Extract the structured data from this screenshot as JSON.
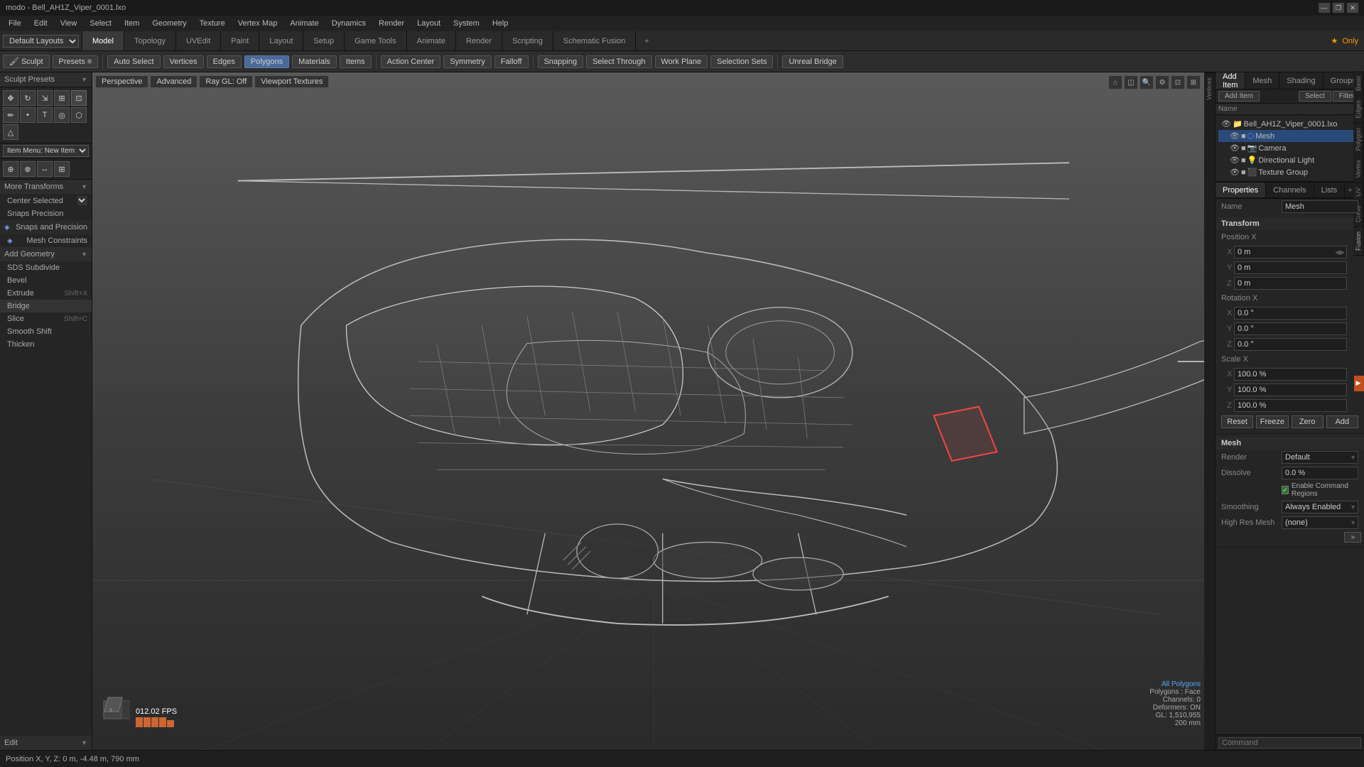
{
  "app": {
    "title": "modo - Bell_AH1Z_Viper_0001.lxo",
    "version": "modo"
  },
  "titlebar": {
    "title": "modo",
    "controls": [
      "—",
      "❐",
      "✕"
    ]
  },
  "menubar": {
    "items": [
      "File",
      "Edit",
      "View",
      "Select",
      "Item",
      "Geometry",
      "Texture",
      "Vertex Map",
      "Animate",
      "Dynamics",
      "Render",
      "Layout",
      "System",
      "Help"
    ]
  },
  "layout_dropdown": "Default Layouts",
  "modetabs": {
    "tabs": [
      "Model",
      "Topology",
      "UVEdit",
      "Paint",
      "Layout",
      "Setup",
      "Game Tools",
      "Animate",
      "Render",
      "Scripting",
      "Schematic Fusion"
    ],
    "active": "Model",
    "add": "+",
    "right": {
      "label": "Only",
      "star": "★"
    }
  },
  "toolbar": {
    "sculpt_label": "Sculpt",
    "presets_label": "Presets",
    "presets_icon": "≡",
    "auto_select": "Auto Select",
    "vertices": "Vertices",
    "edges": "Edges",
    "polygons": "Polygons",
    "materials": "Materials",
    "items": "Items",
    "action_center": "Action Center",
    "symmetry": "Symmetry",
    "falloff": "Falloff",
    "snapping": "Snapping",
    "select_through": "Select Through",
    "work_plane": "Work Plane",
    "selection_sets": "Selection Sets",
    "unreal_bridge": "Unreal Bridge"
  },
  "viewport": {
    "mode": "Perspective",
    "display": "Advanced",
    "render": "Ray GL: Off",
    "textures": "Viewport Textures"
  },
  "left_sidebar": {
    "sculpt_presets_label": "Sculpt Presets",
    "transforms_label": "More Transforms",
    "center_selected": "Center Selected",
    "snaps_precision": "Snaps Precision",
    "snaps_section": "Snaps and Precision",
    "mesh_constraints": "Mesh Constraints",
    "add_geometry": "Add Geometry",
    "sds_subdivide": "SDS Subdivide",
    "bevel": "Bevel",
    "extrude": "Extrude",
    "bridge": "Bridge",
    "slice": "Slice",
    "smooth_shift": "Smooth Shift",
    "thicken": "Thicken",
    "edit_label": "Edit",
    "shortcuts": {
      "extrude": "Shift+X",
      "slice": "Shift+C"
    }
  },
  "scene_tree": {
    "toolbar": {
      "add_item": "Add Item",
      "select": "Select",
      "filter": "Filter"
    },
    "columns": [
      "Name"
    ],
    "items": [
      {
        "name": "Bell_AH1Z_Viper_0001.lxo",
        "type": "file",
        "indent": 0,
        "expanded": true
      },
      {
        "name": "Mesh",
        "type": "mesh",
        "indent": 1,
        "selected": true
      },
      {
        "name": "Camera",
        "type": "camera",
        "indent": 1
      },
      {
        "name": "Directional Light",
        "type": "light",
        "indent": 1
      },
      {
        "name": "Texture Group",
        "type": "texture",
        "indent": 1
      }
    ]
  },
  "properties": {
    "tabs": [
      "Properties",
      "Channels",
      "Lists"
    ],
    "name_label": "Name",
    "name_value": "Mesh",
    "transform": {
      "label": "Transform",
      "position": {
        "label": "Position X",
        "x": "0 m",
        "y": "0 m",
        "z": "0 m"
      },
      "rotation": {
        "label": "Rotation X",
        "x": "0.0 °",
        "y": "0.0 °",
        "z": "0.0 °"
      },
      "scale": {
        "label": "Scale X",
        "x": "100.0 %",
        "y": "100.0 %",
        "z": "100.0 %"
      },
      "buttons": [
        "Reset",
        "Freeze",
        "Zero",
        "Add"
      ]
    },
    "mesh": {
      "label": "Mesh",
      "render": {
        "label": "Render",
        "value": "Default"
      },
      "dissolve": {
        "label": "Dissolve",
        "value": "0.0 %"
      },
      "enable_cmd_regions": {
        "label": "Enable Command Regions",
        "checked": true
      },
      "smoothing": {
        "label": "Smoothing",
        "value": "Always Enabled"
      },
      "high_res_mesh": {
        "label": "High Res Mesh",
        "value": "(none)"
      }
    }
  },
  "bottom_bar": {
    "position": "Position X, Y, Z:  0 m, -4.48 m, 790 mm"
  },
  "viewport_info": {
    "fps": "012.02 FPS",
    "poly_label": "All Polygons",
    "polygons_face": "Polygons : Face",
    "channels": "Channels: 0",
    "deformers": "Deformers: ON",
    "gl": "GL: 1,510,955",
    "scale": "200 mm"
  },
  "vertical_tabs": {
    "items": [
      "Basic",
      "Edges",
      "Polygon",
      "Vertex",
      "UV",
      "Curve",
      "Fusion"
    ]
  },
  "command_label": "Command"
}
